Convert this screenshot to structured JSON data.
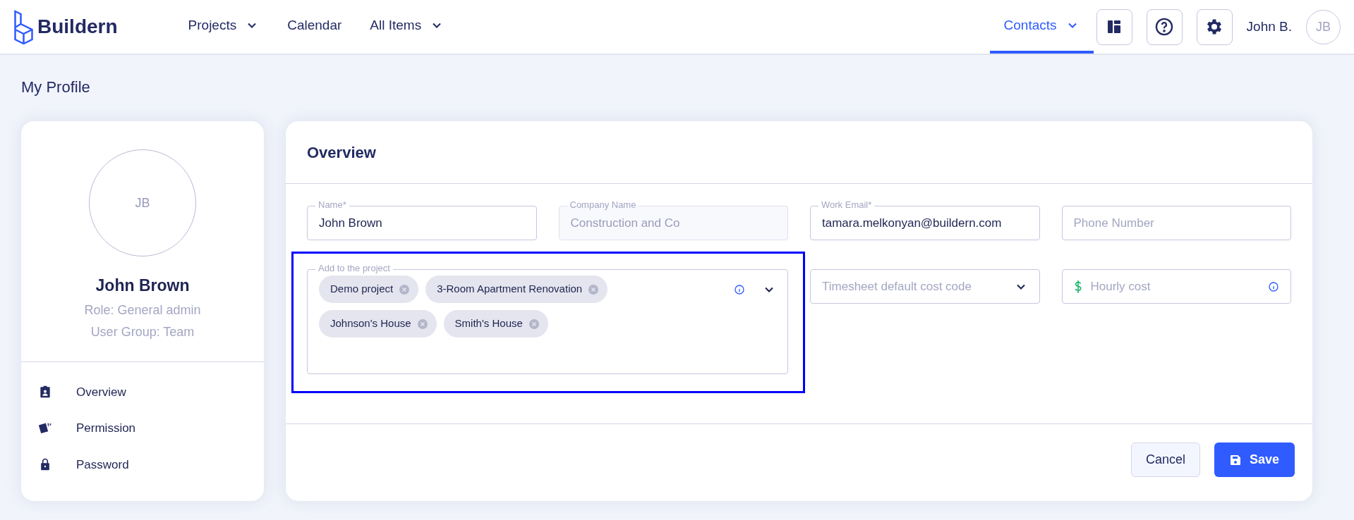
{
  "brand": {
    "name": "Buildern"
  },
  "nav": [
    {
      "label": "Projects",
      "dropdown": true,
      "selected": false
    },
    {
      "label": "Calendar",
      "dropdown": false,
      "selected": false
    },
    {
      "label": "All Items",
      "dropdown": true,
      "selected": false
    }
  ],
  "nav_right": [
    {
      "label": "Contacts",
      "dropdown": true,
      "selected": true
    }
  ],
  "toolbar": [
    {
      "kind": "layout"
    },
    {
      "kind": "help"
    },
    {
      "kind": "settings"
    }
  ],
  "user": {
    "name": "John B.",
    "initials": "JB"
  },
  "page_title": "My Profile",
  "profile": {
    "initials": "JB",
    "name": "John Brown",
    "role": "Role: General admin",
    "group": "User Group: Team",
    "menu": [
      {
        "kind": "overview",
        "label": "Overview"
      },
      {
        "kind": "permission",
        "label": "Permission"
      },
      {
        "kind": "password",
        "label": "Password"
      }
    ]
  },
  "overview": {
    "title": "Overview",
    "fields": [
      {
        "kind": "text",
        "label": "Name*",
        "value": "John Brown",
        "disabled": false
      },
      {
        "kind": "text",
        "label": "Company Name",
        "value": "Construction and Co",
        "disabled": true
      },
      {
        "kind": "text",
        "label": "Work Email*",
        "value": "tamara.melkonyan@buildern.com",
        "disabled": false
      },
      {
        "kind": "text",
        "placeholder": "Phone Number",
        "disabled": false
      },
      {
        "kind": "tags",
        "label": "Add to the project",
        "highlighted": true,
        "tags": [
          "Demo project",
          "3-Room Apartment Renovation",
          "Johnson's House",
          "Smith's House"
        ]
      },
      {
        "kind": "select",
        "placeholder": "Timesheet default cost code"
      },
      {
        "kind": "currency",
        "placeholder": "Hourly cost"
      }
    ]
  },
  "buttons": [
    {
      "kind": "secondary",
      "label": "Cancel"
    },
    {
      "kind": "primary",
      "label": "Save"
    }
  ]
}
